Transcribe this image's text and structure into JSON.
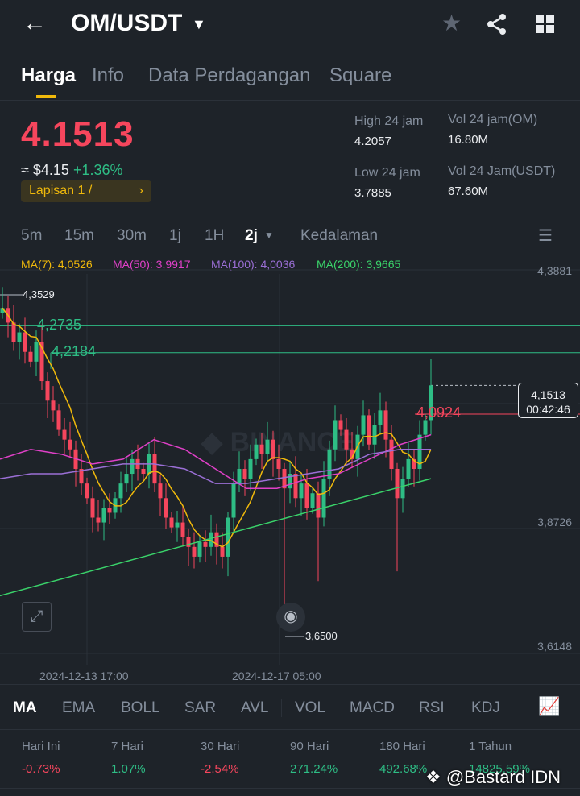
{
  "header": {
    "title": "OM/USDT"
  },
  "tabs": [
    "Harga",
    "Info",
    "Data Perdagangan",
    "Square"
  ],
  "price": {
    "last": "4.1513",
    "usd": "≈ $4.15",
    "change": "+1.36%",
    "layer": "Lapisan 1 /"
  },
  "stats": {
    "high_label": "High 24 jam",
    "high": "4.2057",
    "low_label": "Low 24 jam",
    "low": "3.7885",
    "vol_om_label": "Vol 24 jam(OM)",
    "vol_om": "16.80M",
    "vol_usdt_label": "Vol 24 Jam(USDT)",
    "vol_usdt": "67.60M"
  },
  "intervals": [
    "5m",
    "15m",
    "30m",
    "1j",
    "1H",
    "2j",
    "Kedalaman"
  ],
  "ma_legend": [
    "MA(7): 4,0526",
    "MA(50): 3,9917",
    "MA(100): 4,0036",
    "MA(200): 3,9665"
  ],
  "colors": {
    "ma7": "#f0b90b",
    "ma50": "#e040c8",
    "ma100": "#9b6fd6",
    "ma200": "#3ad36a",
    "up": "#2ebd85",
    "down": "#f6465d"
  },
  "chart_data": {
    "type": "candlestick",
    "y_ticks": [
      "4,3881",
      "3,8726",
      "3,6148"
    ],
    "x_ticks": [
      "2024-12-13 17:00",
      "2024-12-17 05:00"
    ],
    "ylim": [
      3.6148,
      4.3881
    ],
    "closes": [
      4.31,
      4.28,
      4.24,
      4.26,
      4.22,
      4.2,
      4.24,
      4.16,
      4.12,
      4.1,
      4.06,
      4.04,
      4.02,
      3.98,
      3.95,
      3.92,
      3.88,
      3.87,
      3.9,
      3.89,
      3.92,
      3.95,
      3.97,
      4.0,
      3.98,
      3.97,
      4.01,
      3.95,
      3.92,
      3.88,
      3.86,
      3.87,
      3.84,
      3.82,
      3.8,
      3.83,
      3.82,
      3.85,
      3.82,
      3.8,
      3.88,
      3.95,
      3.98,
      3.96,
      4.0,
      4.03,
      4.01,
      4.04,
      4.0,
      3.98,
      3.94,
      3.97,
      3.92,
      3.95,
      3.9,
      3.93,
      3.88,
      3.96,
      4.02,
      4.08,
      4.06,
      4.02,
      4.0,
      4.05,
      4.09,
      4.03,
      4.07,
      4.1,
      4.04,
      3.98,
      3.92,
      3.96,
      4.0,
      3.98,
      4.05,
      4.08,
      4.1513
    ],
    "ma50": [
      4.0,
      4.02,
      4.01,
      3.99,
      4.0,
      4.04,
      4.02,
      3.98,
      3.94,
      3.94,
      3.96,
      3.97,
      4.0,
      4.03,
      4.05
    ],
    "ma100": [
      3.96,
      3.97,
      3.97,
      3.98,
      3.99,
      3.99,
      3.98,
      3.95,
      3.95,
      3.96,
      3.97,
      3.98,
      4.01,
      4.02,
      4.02
    ],
    "ma200": [
      3.72,
      3.8
    ],
    "annotations": {
      "high_mark": "4,3529",
      "low_mark": "3,6500",
      "line1": "4,2735",
      "line2": "4,2184",
      "order": "4,0924",
      "last": "4,1513",
      "countdown": "00:42:46"
    }
  },
  "indicators": [
    "MA",
    "EMA",
    "BOLL",
    "SAR",
    "AVL",
    "VOL",
    "MACD",
    "RSI",
    "KDJ"
  ],
  "performance": [
    {
      "label": "Hari Ini",
      "value": "-0.73%",
      "dir": "red"
    },
    {
      "label": "7 Hari",
      "value": "1.07%",
      "dir": "green"
    },
    {
      "label": "30 Hari",
      "value": "-2.54%",
      "dir": "red"
    },
    {
      "label": "90 Hari",
      "value": "271.24%",
      "dir": "green"
    },
    {
      "label": "180 Hari",
      "value": "492.68%",
      "dir": "green"
    },
    {
      "label": "1 Tahun",
      "value": "14825.59%",
      "dir": "green"
    }
  ],
  "watermark": "@Bastard IDN"
}
